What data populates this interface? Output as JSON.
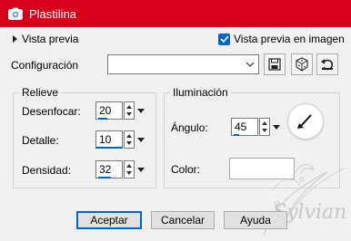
{
  "window": {
    "title": "Plastilina"
  },
  "preview": {
    "toggle_label": "Vista previa",
    "checkbox_label": "Vista previa en imagen",
    "checked": true
  },
  "config": {
    "label": "Configuración",
    "selected_value": ""
  },
  "relieve": {
    "title": "Relieve",
    "fields": [
      {
        "label": "Desenfocar:",
        "value": "20"
      },
      {
        "label": "Detalle:",
        "value": "10"
      },
      {
        "label": "Densidad:",
        "value": "32"
      }
    ]
  },
  "iluminacion": {
    "title": "Iluminación",
    "angle": {
      "label": "Ángulo:",
      "value": "45"
    },
    "color": {
      "label": "Color:",
      "value": "#ffffff"
    }
  },
  "buttons": {
    "ok": "Aceptar",
    "cancel": "Cancelar",
    "help": "Ayuda"
  },
  "colors": {
    "titlebar": "#d9001b",
    "accent": "#0067c0"
  },
  "watermark": {
    "text": "Sylvian"
  }
}
